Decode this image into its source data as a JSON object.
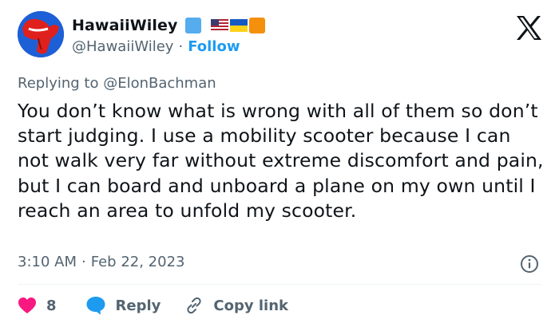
{
  "author": {
    "display_name": "HawaiiWiley",
    "handle": "@HawaiiWiley",
    "follow_label": "Follow",
    "separator": "·",
    "name_emojis": [
      "blue-square",
      "us-flag",
      "ukraine-flag",
      "orange-square"
    ]
  },
  "reply_context": {
    "label": "Replying to @ElonBachman"
  },
  "tweet": {
    "text": "You don’t know what is wrong with all of them so don’t start judging. I use a mobility scooter because I can not walk very far without extreme discomfort and pain, but I can board and unboard a plane on my own until I reach an area to unfold my scooter.",
    "time": "3:10 AM",
    "separator": "·",
    "date": "Feb 22, 2023"
  },
  "actions": {
    "like_count": "8",
    "reply_label": "Reply",
    "copy_link_label": "Copy link"
  },
  "colors": {
    "text": "#0f1419",
    "muted": "#536471",
    "accent": "#1d9bf0",
    "like": "#f91880",
    "divider": "#eff3f4"
  },
  "icons": {
    "brand": "x-logo-icon",
    "info": "info-icon",
    "like": "heart-icon",
    "reply": "speech-bubble-icon",
    "copy": "link-icon"
  }
}
